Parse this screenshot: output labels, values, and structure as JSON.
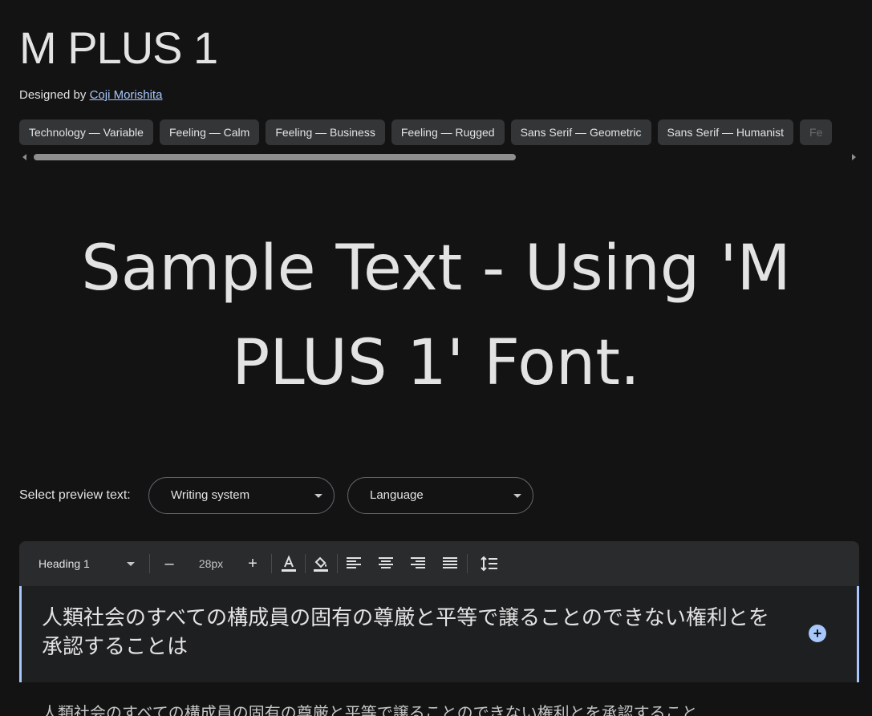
{
  "font": {
    "name": "M PLUS 1",
    "designed_by_label": "Designed by",
    "designer": "Coji Morishita"
  },
  "tags": [
    "Technology — Variable",
    "Feeling — Calm",
    "Feeling — Business",
    "Feeling — Rugged",
    "Sans Serif — Geometric",
    "Sans Serif — Humanist",
    "Fe"
  ],
  "sample_text": "Sample Text - Using 'M PLUS 1' Font.",
  "preview": {
    "label": "Select preview text:",
    "writing_system": "Writing system",
    "language": "Language"
  },
  "toolbar": {
    "style": "Heading 1",
    "decrease": "–",
    "size": "28px",
    "increase": "+",
    "text_color_icon": "text-color-icon",
    "fill_color_icon": "fill-color-icon",
    "align_left_icon": "align-left-icon",
    "align_center_icon": "align-center-icon",
    "align_right_icon": "align-right-icon",
    "align_justify_icon": "align-justify-icon",
    "line_height_icon": "line-height-icon"
  },
  "editor": {
    "heading_text": "人類社会のすべての構成員の固有の尊厳と平等で譲ることのできない権利とを承認することは",
    "add_icon": "add-circle-icon"
  },
  "paragraph_text": "人類社会のすべての構成員の固有の尊厳と平等で譲ることのできない権利とを承認すること",
  "colors": {
    "background": "#131314",
    "accent": "#a8c7fa",
    "chip": "#333537",
    "toolbar": "#2a2b2d"
  }
}
